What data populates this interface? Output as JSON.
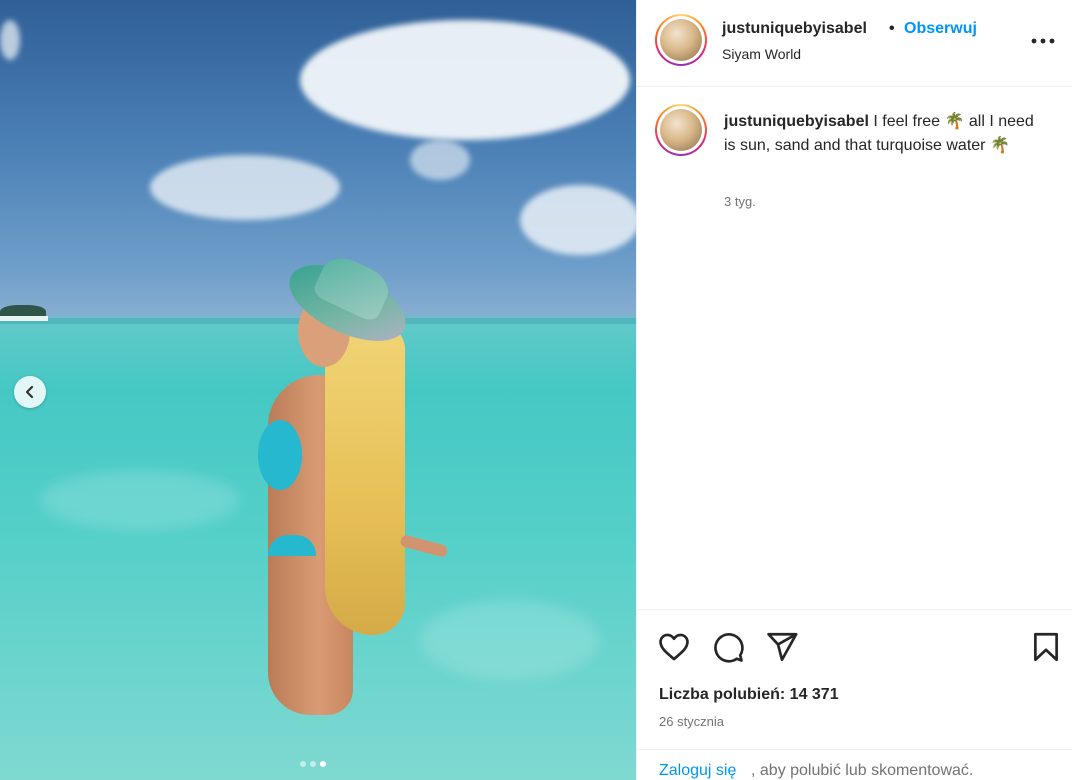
{
  "post": {
    "username": "justuniquebyisabel",
    "separator": "•",
    "follow_label": "Obserwuj",
    "location": "Siyam World",
    "more_icon": "more-horizontal-icon"
  },
  "media": {
    "prev_icon": "chevron-left-icon",
    "slide_count": 3,
    "active_slide": 3
  },
  "caption": {
    "username": "justuniquebyisabel",
    "text": " I feel free 🌴 all I need is sun, sand and that turquoise water 🌴",
    "time": "3 tyg."
  },
  "actions": {
    "icons": [
      "heart-icon",
      "comment-icon",
      "share-icon",
      "bookmark-icon"
    ],
    "likes": "Liczba polubień: 14 371",
    "date": "26 stycznia",
    "login_link": "Zaloguj się",
    "login_rest": ", aby polubić lub skomentować."
  },
  "colors": {
    "link_blue": "#0095f6",
    "text": "#262626",
    "muted": "#737373"
  }
}
